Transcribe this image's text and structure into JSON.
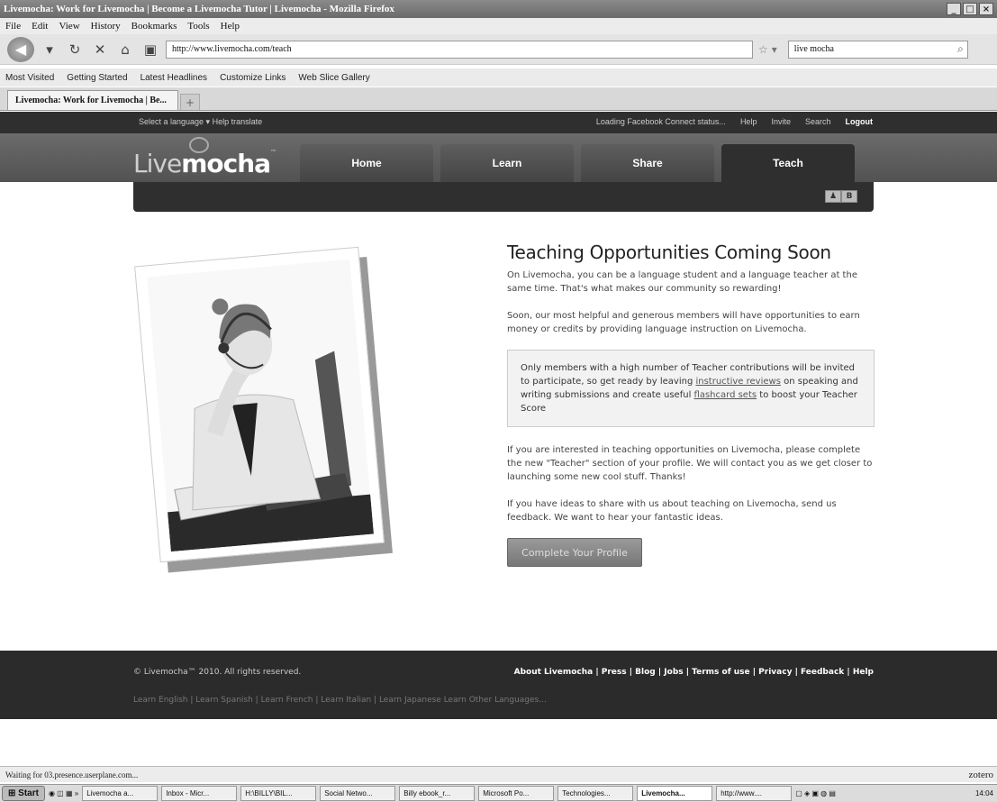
{
  "browser": {
    "window_title": "Livemocha: Work for Livemocha | Become a Livemocha Tutor | Livemocha - Mozilla Firefox",
    "menu": [
      "File",
      "Edit",
      "View",
      "History",
      "Bookmarks",
      "Tools",
      "Help"
    ],
    "url": "http://www.livemocha.com/teach",
    "search_value": "live mocha",
    "bookmarks": [
      "Most Visited",
      "Getting Started",
      "Latest Headlines",
      "Customize Links",
      "Web Slice Gallery"
    ],
    "tab_label": "Livemocha: Work for Livemocha | Be...",
    "status": "Waiting for 03.presence.userplane.com...",
    "zotero": "zotero"
  },
  "site": {
    "top_left": "Select a language ▾   Help translate",
    "top_links": [
      "Loading Facebook Connect status...",
      "Help",
      "Invite",
      "Search"
    ],
    "logout": "Logout",
    "logo_light": "Live",
    "logo_bold": "mocha",
    "nav": [
      "Home",
      "Learn",
      "Share",
      "Teach"
    ],
    "active_nav": "Teach"
  },
  "main": {
    "heading": "Teaching Opportunities Coming Soon",
    "para1": "On Livemocha, you can be a language student and a language teacher at the same time. That's what makes our community so rewarding!",
    "para2": "Soon, our most helpful and generous members will have opportunities to earn money or credits by providing language instruction on Livemocha.",
    "note_part1": "Only members with a high number of Teacher contributions will be invited to participate, so get ready by leaving ",
    "note_link1": "instructive reviews",
    "note_part2": " on speaking and writing submissions and create useful ",
    "note_link2": "flashcard sets",
    "note_part3": " to boost your Teacher Score",
    "para3": "If you are interested in teaching opportunities on Livemocha, please complete the new \"Teacher\" section of your profile. We will contact you as we get closer to launching some new cool stuff. Thanks!",
    "para4": "If you have ideas to share with us about teaching on Livemocha, send us feedback. We want to hear your fantastic ideas.",
    "cta": "Complete Your Profile"
  },
  "footer": {
    "copyright": "© Livemocha™ 2010. All rights reserved.",
    "links": "About Livemocha | Press | Blog | Jobs | Terms of use | Privacy | Feedback | Help",
    "languages": "Learn English | Learn Spanish | Learn French | Learn Italian | Learn Japanese    Learn Other Languages..."
  },
  "taskbar": {
    "start": "Start",
    "tasks": [
      "Livemocha a...",
      "Inbox - Micr...",
      "H:\\BILLY\\BIL...",
      "Social Netwo...",
      "Billy ebook_r...",
      "Microsoft Po...",
      "Technologies...",
      "Livemocha...",
      "http://www...."
    ],
    "active_task_index": 7,
    "clock": "14:04"
  }
}
